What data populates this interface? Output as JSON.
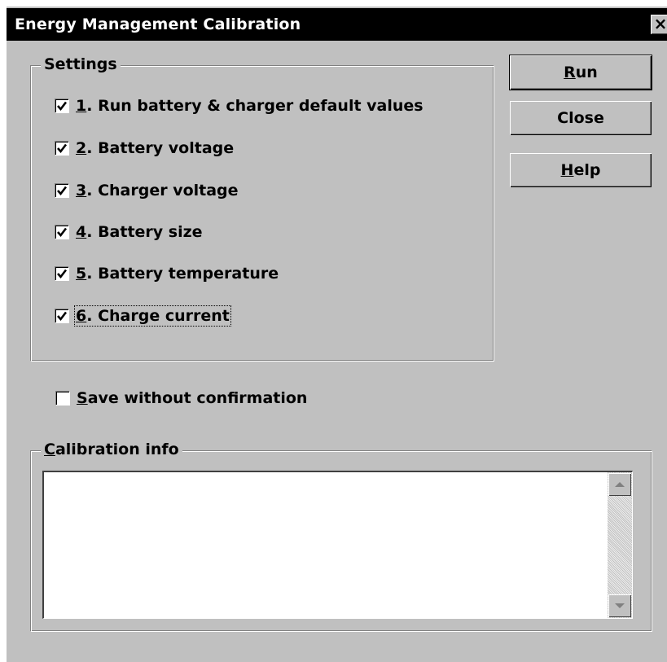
{
  "window": {
    "title": "Energy Management Calibration",
    "close_glyph": "×"
  },
  "settings": {
    "group_label": "Settings",
    "items": [
      {
        "num": "1",
        "label": ". Run battery & charger default values",
        "checked": true
      },
      {
        "num": "2",
        "label": ". Battery voltage",
        "checked": true
      },
      {
        "num": "3",
        "label": ". Charger voltage",
        "checked": true
      },
      {
        "num": "4",
        "label": ". Battery size",
        "checked": true
      },
      {
        "num": "5",
        "label": ". Battery temperature",
        "checked": true
      },
      {
        "num": "6",
        "label": ". Charge current",
        "checked": true
      }
    ]
  },
  "buttons": {
    "run": {
      "mnemonic": "R",
      "rest": "un"
    },
    "close": {
      "label": "Close"
    },
    "help": {
      "mnemonic": "H",
      "rest": "elp"
    }
  },
  "save_option": {
    "mnemonic": "S",
    "rest": "ave without confirmation",
    "checked": false
  },
  "calibration_info": {
    "group_mnemonic": "C",
    "group_rest": "alibration info",
    "content": ""
  },
  "icons": {
    "checkmark": "checkmark-icon",
    "scroll_up": "scroll-up-arrow-icon",
    "scroll_down": "scroll-down-arrow-icon",
    "close": "close-icon"
  }
}
